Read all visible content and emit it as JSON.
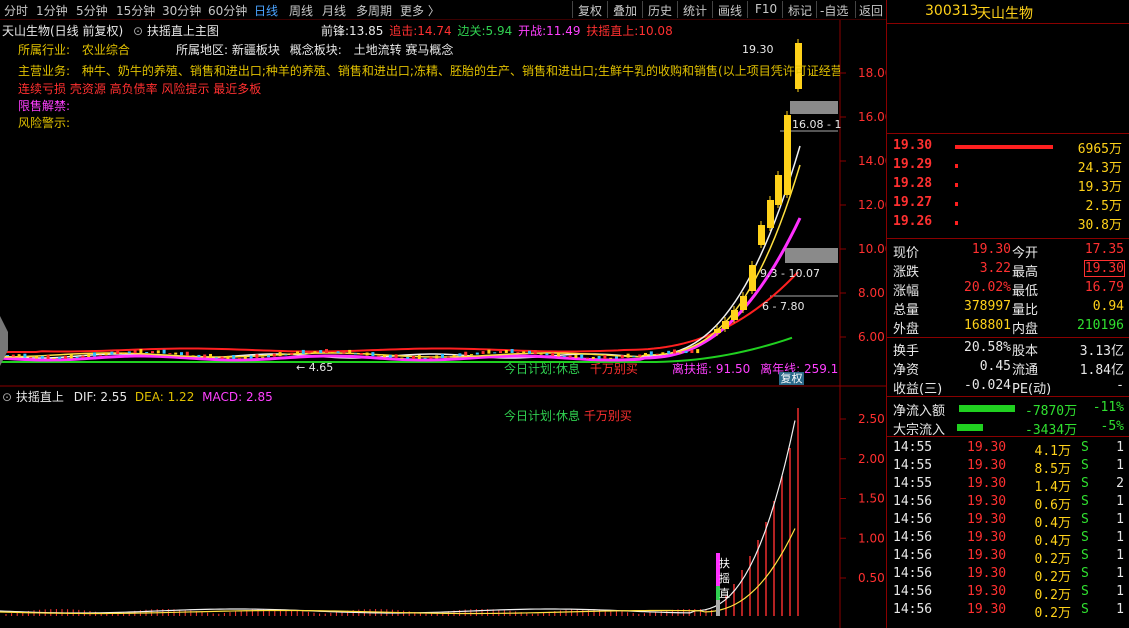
{
  "toolbar": {
    "left": [
      "分时",
      "1分钟",
      "5分钟",
      "15分钟",
      "30分钟",
      "60分钟",
      "日线",
      "周线",
      "月线",
      "多周期",
      "更多 〉"
    ],
    "right": [
      "复权",
      "叠加",
      "历史",
      "统计",
      "画线",
      "F10",
      "标记",
      "-自选",
      "返回"
    ]
  },
  "chart_header": {
    "title": "天山生物(日线 前复权)",
    "indicator": "扶摇直上主图",
    "qianfeng_label": "前锋:",
    "qianfeng_value": "13.85",
    "zhuiji_label": "追击:",
    "zhuiji_value": "14.74",
    "bianguan_label": "边关:",
    "bianguan_value": "5.94",
    "kaizhan_label": "开战:",
    "kaizhan_value": "11.49",
    "fuyao_label": "扶摇直上:",
    "fuyao_value": "10.08"
  },
  "info": {
    "industry_label": "所属行业:",
    "industry": "农业综合",
    "region_label": "所属地区:",
    "region": "新疆板块",
    "concept_label": "概念板块:",
    "concept": "土地流转 赛马概念",
    "business_label": "主营业务:",
    "business": "种牛、奶牛的养殖、销售和进出口;种羊的养殖、销售和进出口;冻精、胚胎的生产、销售和进出口;生鲜牛乳的收购和销售(以上项目凭许可证经营",
    "risk_tags": "连续亏损 壳资源 高负债率 风险提示 最近多板",
    "unlock_label": "限售解禁:",
    "warning_label": "风险警示:"
  },
  "main_chart": {
    "annotations": {
      "high_label": "19.30",
      "zone1_label": "16.08 - 1",
      "zone2_label": "9.3 - 10.07",
      "zone3_label": "6 - 7.80",
      "low_label": "← 4.65",
      "plan_label": "今日计划:",
      "plan_value": "休息",
      "plan_advice": "千万别买",
      "li_fuyao_label": "离扶摇:",
      "li_fuyao_value": "91.50",
      "li_nian_label": "离年线:",
      "li_nian_value": "259.1",
      "fuquan_tag": "复权"
    },
    "y_ticks": [
      "18.00",
      "16.00",
      "14.00",
      "12.00",
      "10.00",
      "8.00",
      "6.00"
    ]
  },
  "sub_chart": {
    "title": "扶摇直上",
    "dif_label": "DIF:",
    "dif_value": "2.55",
    "dea_label": "DEA:",
    "dea_value": "1.22",
    "macd_label": "MACD:",
    "macd_value": "2.85",
    "plan_label": "今日计划:",
    "plan_value": "休息",
    "plan_advice": "千万别买",
    "signal_chars": [
      "扶",
      "摇",
      "直"
    ],
    "y_ticks": [
      "2.50",
      "2.00",
      "1.50",
      "1.00",
      "0.50"
    ]
  },
  "quote": {
    "code": "300313",
    "name": "天山生物",
    "bids": [
      {
        "price": "19.30",
        "vol": "6965万",
        "bar": 1.0
      },
      {
        "price": "19.29",
        "vol": "24.3万",
        "bar": 0.004
      },
      {
        "price": "19.28",
        "vol": "19.3万",
        "bar": 0.003
      },
      {
        "price": "19.27",
        "vol": "2.5万",
        "bar": 0.001
      },
      {
        "price": "19.26",
        "vol": "30.8万",
        "bar": 0.005
      }
    ],
    "stats": [
      {
        "l1": "现价",
        "v1": "19.30",
        "l2": "今开",
        "v2": "17.35"
      },
      {
        "l1": "涨跌",
        "v1": "3.22",
        "l2": "最高",
        "v2": "19.30"
      },
      {
        "l1": "涨幅",
        "v1": "20.02%",
        "l2": "最低",
        "v2": "16.79"
      },
      {
        "l1": "总量",
        "v1": "378997",
        "l2": "量比",
        "v2": "0.94"
      },
      {
        "l1": "外盘",
        "v1": "168801",
        "l2": "内盘",
        "v2": "210196"
      }
    ],
    "stats2": [
      {
        "l1": "换手",
        "v1": "20.58%",
        "l2": "股本",
        "v2": "3.13亿"
      },
      {
        "l1": "净资",
        "v1": "0.45",
        "l2": "流通",
        "v2": "1.84亿"
      },
      {
        "l1": "收益(三)",
        "v1": "-0.024",
        "l2": "PE(动)",
        "v2": "-"
      }
    ],
    "flow": [
      {
        "label": "净流入额",
        "value": "-7870万",
        "pct": "-11%"
      },
      {
        "label": "大宗流入",
        "value": "-3434万",
        "pct": "-5%"
      }
    ],
    "ticks": [
      {
        "t": "14:55",
        "p": "19.30",
        "v": "4.1万",
        "d": "S",
        "n": "1"
      },
      {
        "t": "14:55",
        "p": "19.30",
        "v": "8.5万",
        "d": "S",
        "n": "1"
      },
      {
        "t": "14:55",
        "p": "19.30",
        "v": "1.4万",
        "d": "S",
        "n": "2"
      },
      {
        "t": "14:56",
        "p": "19.30",
        "v": "0.6万",
        "d": "S",
        "n": "1"
      },
      {
        "t": "14:56",
        "p": "19.30",
        "v": "0.4万",
        "d": "S",
        "n": "1"
      },
      {
        "t": "14:56",
        "p": "19.30",
        "v": "0.4万",
        "d": "S",
        "n": "1"
      },
      {
        "t": "14:56",
        "p": "19.30",
        "v": "0.2万",
        "d": "S",
        "n": "1"
      },
      {
        "t": "14:56",
        "p": "19.30",
        "v": "0.2万",
        "d": "S",
        "n": "1"
      },
      {
        "t": "14:56",
        "p": "19.30",
        "v": "0.2万",
        "d": "S",
        "n": "1"
      },
      {
        "t": "14:56",
        "p": "19.30",
        "v": "0.2万",
        "d": "S",
        "n": "1"
      }
    ]
  },
  "colors": {
    "up_candle": "#ffd21a",
    "ma_white": "#f0f0f0",
    "ma_magenta": "#ff30ff",
    "ma_red": "#ff2020",
    "ma_green": "#20d020",
    "grid_red": "#8a0000"
  }
}
